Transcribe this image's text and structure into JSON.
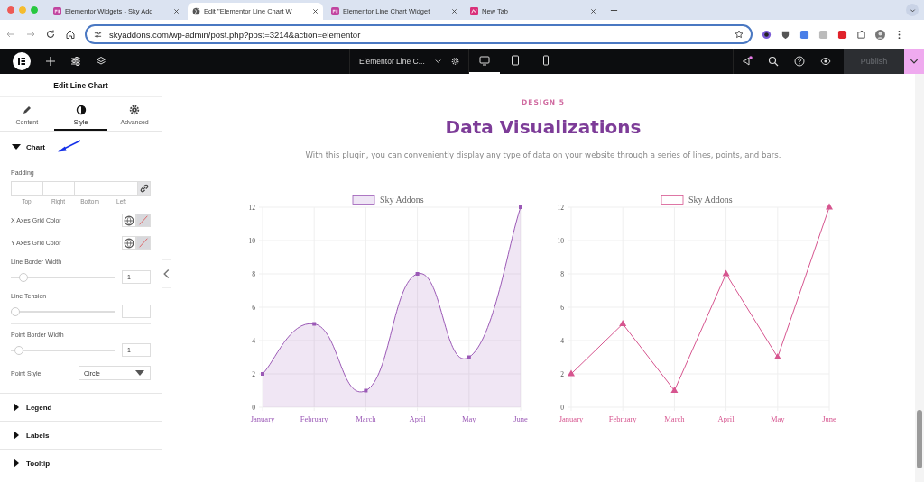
{
  "browser": {
    "tabs": [
      {
        "title": "Elementor Widgets - Sky Add",
        "kind": "site",
        "selected": false
      },
      {
        "title": "Edit \"Elementor Line Chart W",
        "kind": "globe",
        "selected": true
      },
      {
        "title": "Elementor Line Chart Widget",
        "kind": "site",
        "selected": false
      },
      {
        "title": "New Tab",
        "kind": "newtab",
        "selected": false
      }
    ],
    "url": "skyaddons.com/wp-admin/post.php?post=3214&action=elementor"
  },
  "editor_toolbar": {
    "document_title": "Elementor Line C...",
    "devices": [
      {
        "selected": true
      },
      {
        "selected": false
      },
      {
        "selected": false
      }
    ],
    "notification": true,
    "publish": {
      "label": "Publish",
      "disabled": true
    }
  },
  "panel": {
    "title": "Edit Line Chart",
    "tabs": [
      {
        "label": "Content",
        "selected": false
      },
      {
        "label": "Style",
        "selected": true
      },
      {
        "label": "Advanced",
        "selected": false
      }
    ],
    "sections": [
      {
        "title": "Chart",
        "expanded": true,
        "controls": [
          {
            "kind": "dimensions",
            "label": "Padding",
            "fields": [
              "Top",
              "Right",
              "Bottom",
              "Left"
            ]
          },
          {
            "kind": "color",
            "label": "X Axes Grid Color"
          },
          {
            "kind": "color",
            "label": "Y Axes Grid Color"
          },
          {
            "kind": "slider",
            "label": "Line Border Width",
            "level": 0.09,
            "value": "1"
          },
          {
            "kind": "slider",
            "label": "Line Tension",
            "level": 0,
            "divider_after": true
          },
          {
            "kind": "slider",
            "label": "Point Border Width",
            "level": 0.04,
            "value": "1"
          },
          {
            "kind": "select",
            "label": "Point Style",
            "value": "Circle"
          }
        ]
      },
      {
        "title": "Legend",
        "expanded": false
      },
      {
        "title": "Labels",
        "expanded": false
      },
      {
        "title": "Tooltip",
        "expanded": false
      }
    ]
  },
  "canvas": {
    "eyebrow": "DESIGN 5",
    "heading": "Data Visualizations",
    "description": "With this plugin, you can conveniently display any type of data on your website through a series of lines, points, and bars.",
    "charts": [
      {
        "smooth": true,
        "chart_data": {
          "type": "area",
          "grid": true,
          "categories": [
            "January",
            "February",
            "March",
            "April",
            "May",
            "June"
          ],
          "series": [
            {
              "name": "Sky Addons",
              "color": "#9b59b6",
              "marker": "square",
              "values": [
                2,
                5,
                1,
                8,
                3,
                12
              ]
            }
          ],
          "ylim": [
            0,
            12
          ],
          "yticks": [
            0,
            2,
            4,
            6,
            8,
            10,
            12
          ]
        }
      },
      {
        "smooth": false,
        "chart_data": {
          "type": "line",
          "grid": true,
          "categories": [
            "January",
            "February",
            "March",
            "April",
            "May",
            "June"
          ],
          "series": [
            {
              "name": "Sky Addons",
              "color": "#d6558f",
              "marker": "triangle",
              "values": [
                2,
                5,
                1,
                8,
                3,
                12
              ]
            }
          ],
          "ylim": [
            0,
            12
          ],
          "yticks": [
            0,
            2,
            4,
            6,
            8,
            10,
            12
          ]
        }
      }
    ]
  }
}
